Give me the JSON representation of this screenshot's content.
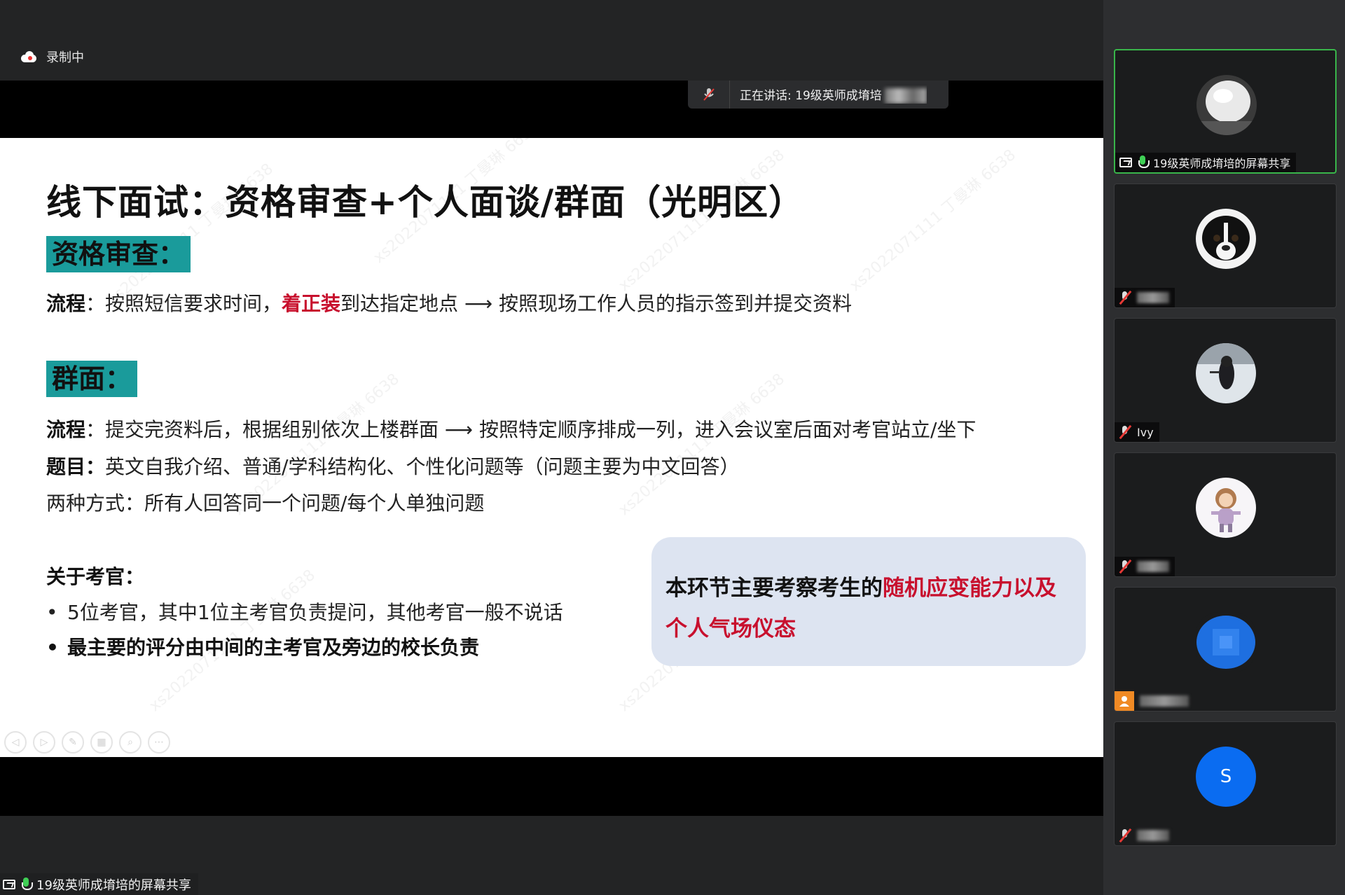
{
  "recording": {
    "label": "录制中"
  },
  "speaking": {
    "text": "正在讲话: 19级英师成堉培"
  },
  "slide": {
    "title": "线下面试：资格审查+个人面谈/群面（光明区）",
    "section1_tag": "资格审查：",
    "flow1": {
      "label": "流程",
      "sep": "：按照短信要求时间，",
      "highlight": "着正装",
      "rest": "到达指定地点 ⟶ 按照现场工作人员的指示签到并提交资料"
    },
    "section2_tag": "群面：",
    "flow2": {
      "label": "流程",
      "text": "：提交完资料后，根据组别依次上楼群面 ⟶ 按照特定顺序排成一列，进入会议室后面对考官站立/坐下"
    },
    "topic": {
      "label": "题目：",
      "text": "英文自我介绍、普通/学科结构化、个性化问题等（问题主要为中文回答）"
    },
    "modes": "两种方式：所有人回答同一个问题/每个人单独问题",
    "examiner_heading": "关于考官：",
    "bullets": [
      "5位考官，其中1位主考官负责提问，其他考官一般不说话",
      "最主要的评分由中间的主考官及旁边的校长负责"
    ],
    "callout": {
      "prefix": "本环节主要考察考生的",
      "highlight": "随机应变能力以及个人气场仪态"
    },
    "watermark": "xs2022071111 丁曼琳 6638"
  },
  "share_label": "19级英师成堉培的屏幕共享",
  "participants": [
    {
      "name": "19级英师成堉培的屏幕共享",
      "muted": false,
      "active": true,
      "avatar": "ice-photo"
    },
    {
      "name": "",
      "muted": true,
      "active": false,
      "avatar": "dog-photo"
    },
    {
      "name": "Ivy",
      "muted": true,
      "active": false,
      "avatar": "snow-photo"
    },
    {
      "name": "",
      "muted": true,
      "active": false,
      "avatar": "cartoon-girl"
    },
    {
      "name": "",
      "muted": false,
      "active": false,
      "avatar": "blue-placeholder"
    },
    {
      "name": "",
      "muted": true,
      "active": false,
      "avatar": "letter-s",
      "letter": "S"
    }
  ],
  "colors": {
    "accent_teal": "#1a9b9b",
    "highlight_red": "#c8102e",
    "callout_bg": "#dde4f1",
    "active_border": "#39b54a"
  }
}
